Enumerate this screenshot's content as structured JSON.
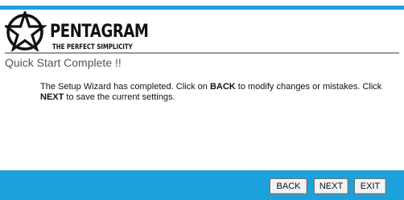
{
  "brand": {
    "name": "PENTAGRAM",
    "tagline": "THE PERFECT SIMPLICITY"
  },
  "page": {
    "title": "Quick Start Complete !!"
  },
  "message": {
    "part1": "The Setup Wizard has completed. Click on ",
    "back_keyword": "BACK",
    "part2": " to modify changes or mistakes. Click ",
    "next_keyword": "NEXT",
    "part3": " to save the current settings."
  },
  "buttons": {
    "back": "BACK",
    "next": "NEXT",
    "exit": "EXIT"
  },
  "colors": {
    "accent_bar": "#1ba2dc",
    "divider": "#9a9a9a",
    "title_text": "#555555"
  }
}
